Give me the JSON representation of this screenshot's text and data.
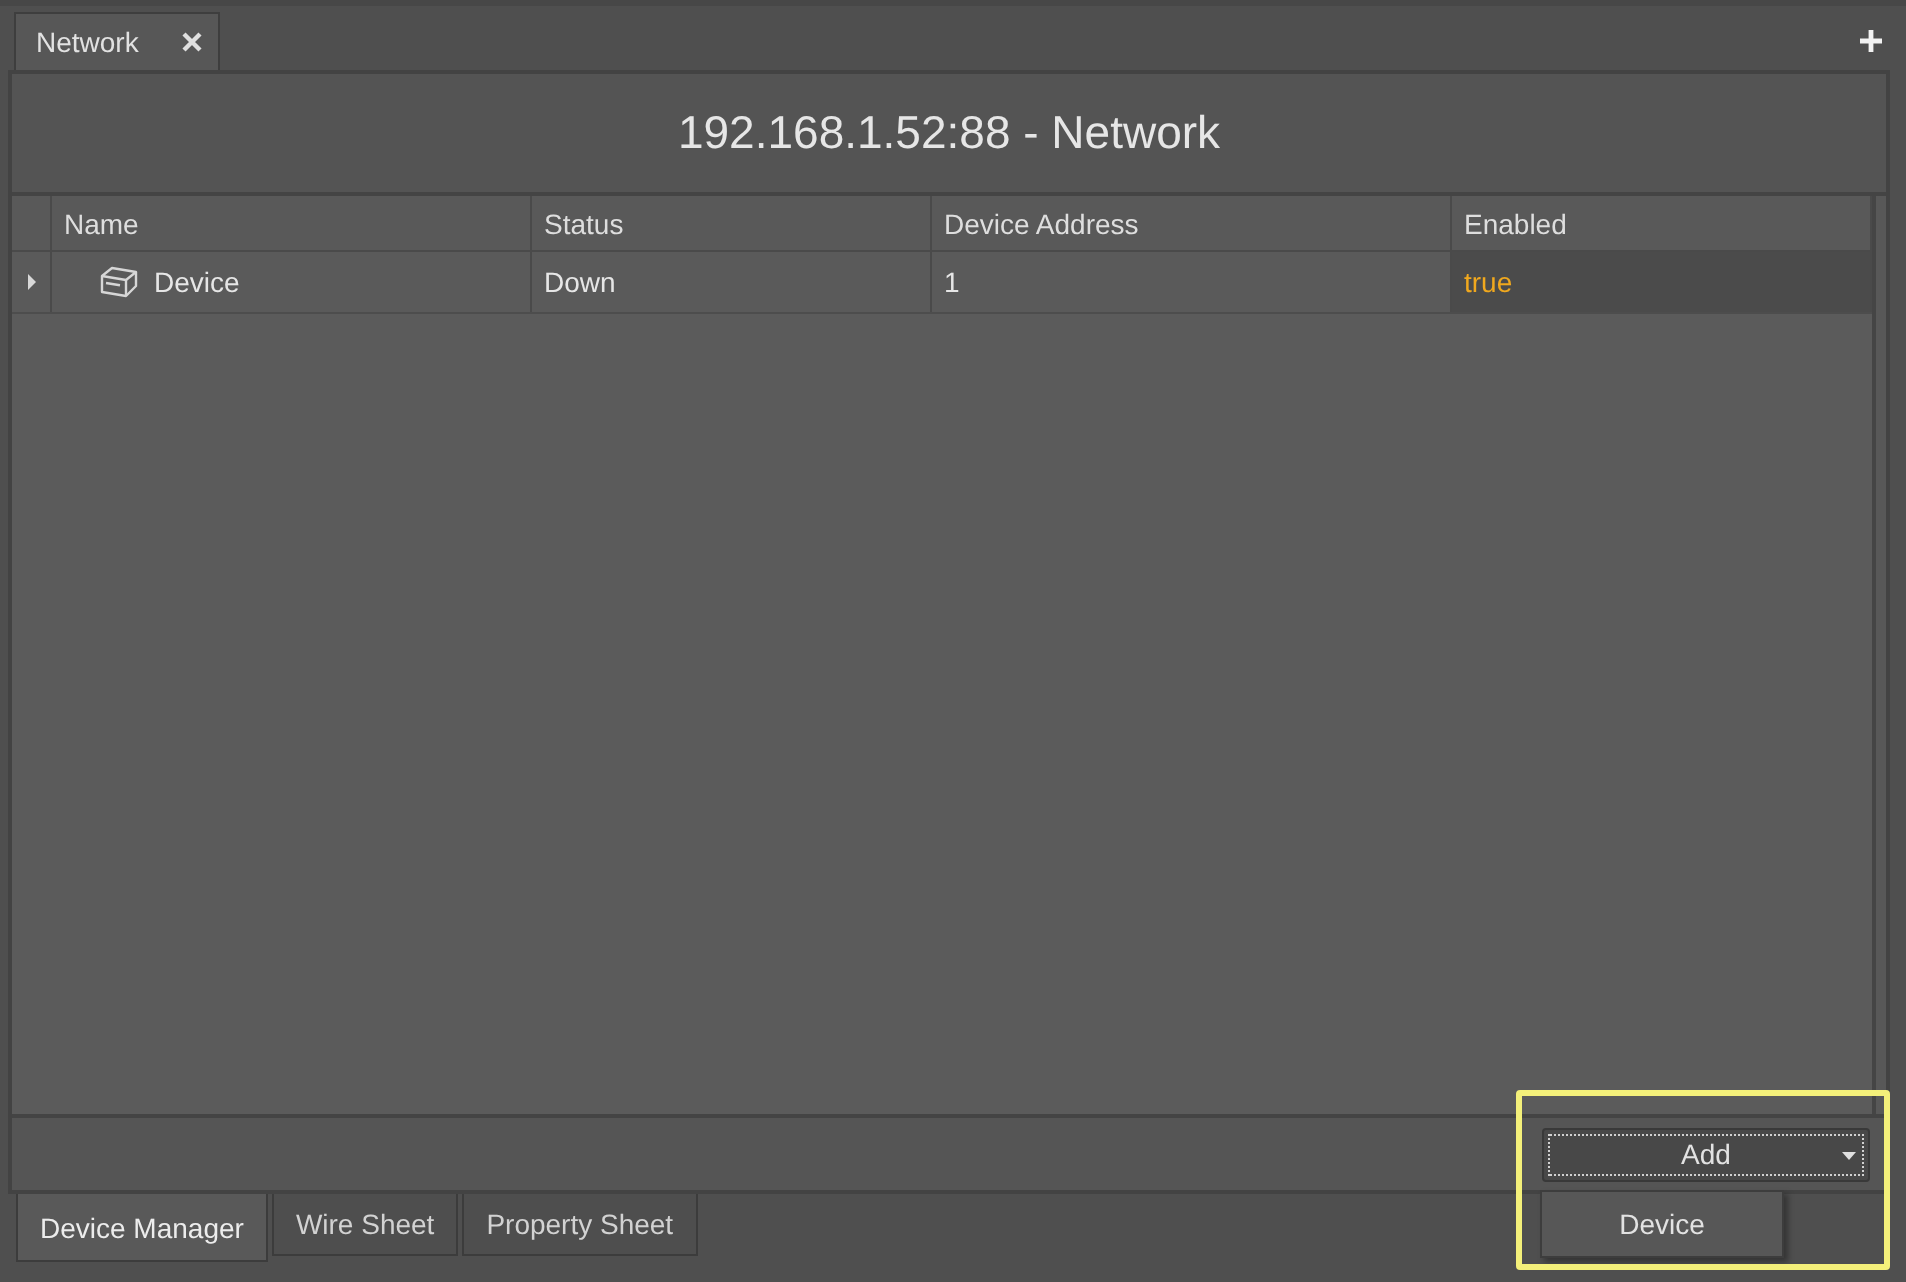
{
  "document_tabs": [
    {
      "label": "Network",
      "selected": true,
      "closable": true
    }
  ],
  "view": {
    "title": "192.168.1.52:88 - Network"
  },
  "table": {
    "columns": [
      "Name",
      "Status",
      "Device Address",
      "Enabled"
    ],
    "rows": [
      {
        "expanded": false,
        "cells": [
          {
            "kind": "device",
            "text": "Device"
          },
          {
            "kind": "text",
            "text": "Down"
          },
          {
            "kind": "text",
            "text": "1"
          },
          {
            "kind": "boolean",
            "text": "true"
          }
        ]
      }
    ]
  },
  "add_button": {
    "label": "Add",
    "focused": true,
    "menu_open": true,
    "menu_items": [
      "Device"
    ]
  },
  "highlight_add_area": true,
  "bottom_tabs": [
    {
      "label": "Device Manager",
      "selected": true
    },
    {
      "label": "Wire Sheet",
      "selected": false
    },
    {
      "label": "Property Sheet",
      "selected": false
    }
  ]
}
